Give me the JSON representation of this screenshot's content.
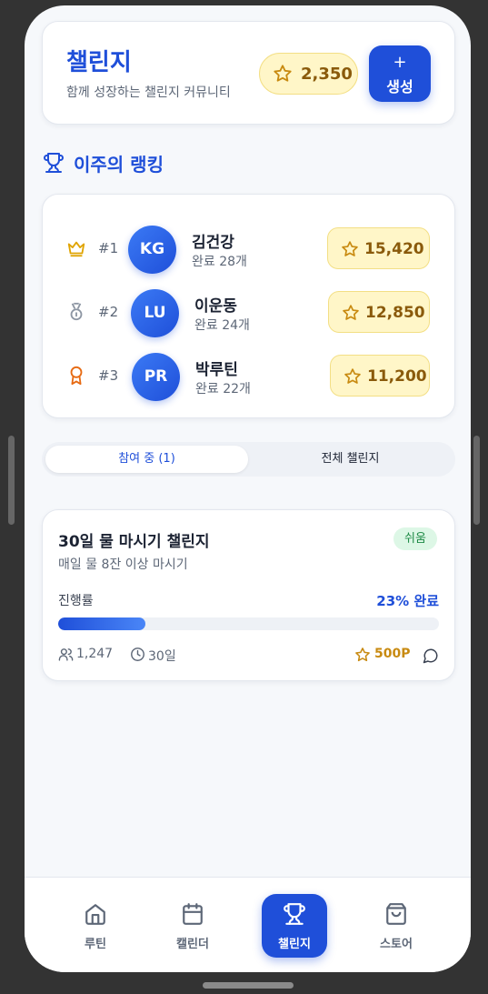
{
  "header": {
    "title": "챌린지",
    "subtitle": "함께 성장하는 챌린지 커뮤니티",
    "points": "2,350",
    "create_icon": "+",
    "create_label": "생성"
  },
  "ranking": {
    "heading": "이주의 랭킹",
    "rows": [
      {
        "rank": "#1",
        "medal_icon": "crown-icon",
        "initials": "KG",
        "name": "김건강",
        "completed": "완료 28개",
        "score": "15,420"
      },
      {
        "rank": "#2",
        "medal_icon": "medal-icon",
        "initials": "LU",
        "name": "이운동",
        "completed": "완료 24개",
        "score": "12,850"
      },
      {
        "rank": "#3",
        "medal_icon": "award-icon",
        "initials": "PR",
        "name": "박루틴",
        "completed": "완료 22개",
        "score": "11,200"
      }
    ]
  },
  "tabs": {
    "active": "참여 중 (1)",
    "inactive": "전체 챌린지"
  },
  "challenge": {
    "title": "30일 물 마시기 챌린지",
    "badge": "쉬움",
    "description": "매일 물 8잔 이상 마시기",
    "progress_label": "진행률",
    "progress_text": "23% 완료",
    "progress_fraction": 0.23,
    "participants": "1,247",
    "duration": "30일",
    "reward": "500P"
  },
  "nav": {
    "items": [
      {
        "label": "루틴",
        "icon": "home-icon"
      },
      {
        "label": "캘린더",
        "icon": "calendar-icon"
      },
      {
        "label": "챌린지",
        "icon": "trophy-icon",
        "active": true
      },
      {
        "label": "스토어",
        "icon": "shopping-bag-icon"
      }
    ]
  },
  "colors": {
    "primary": "#1f4fd9",
    "gold": "#c88a10",
    "gold_bg": "#fff6c8",
    "easy_badge_bg": "#ddf7e6",
    "easy_badge_text": "#1d8a45"
  }
}
